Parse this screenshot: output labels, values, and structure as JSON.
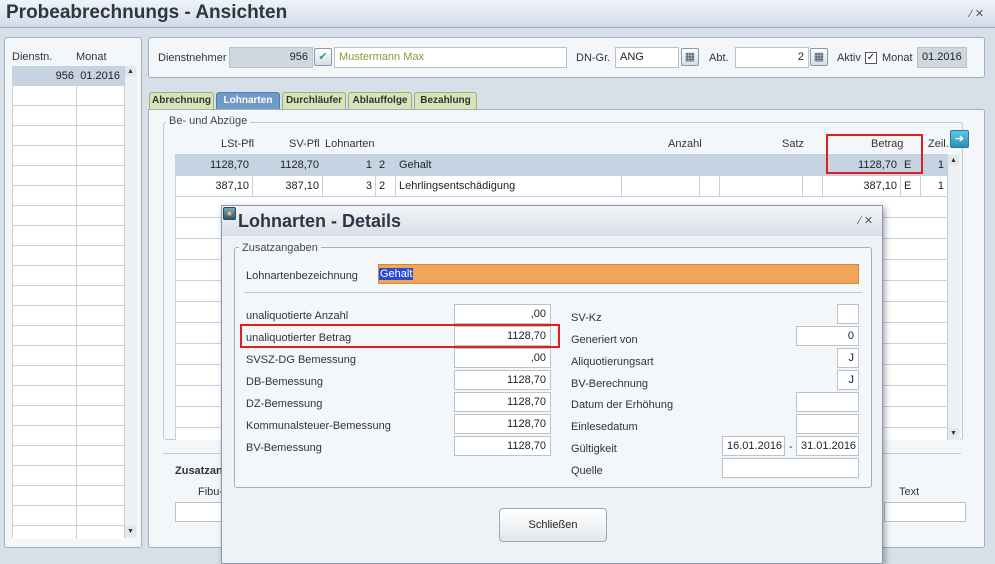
{
  "window": {
    "title": "Probeabrechnungs - Ansichten",
    "controls": "∕ ✕"
  },
  "left_list": {
    "headers": [
      "Dienstn.",
      "Monat"
    ],
    "rows": [
      {
        "dienstn": "956",
        "monat": "01.2016"
      }
    ]
  },
  "header_form": {
    "dienstnehmer_label": "Dienstnehmer",
    "dienstnehmer_nr": "956",
    "dienstnehmer_name": "Mustermann Max",
    "dngr_label": "DN-Gr.",
    "dngr_value": "ANG",
    "abt_label": "Abt.",
    "abt_value": "2",
    "aktiv_label": "Aktiv",
    "monat_label": "Monat",
    "monat_value": "01.2016"
  },
  "tabs": [
    "Abrechnung",
    "Lohnarten",
    "Durchläufer",
    "Ablauffolge",
    "Bezahlung"
  ],
  "active_tab": "Lohnarten",
  "table": {
    "group_title": "Be- und Abzüge",
    "headers": {
      "lst": "LSt-Pfl",
      "sv": "SV-Pfl",
      "lohnarten": "Lohnarten",
      "anzahl": "Anzahl",
      "satz": "Satz",
      "betrag": "Betrag",
      "zeil": "Zeil."
    },
    "rows": [
      {
        "lst": "1128,70",
        "sv": "1128,70",
        "la1": "1",
        "la2": "2",
        "bez": "Gehalt",
        "betrag": "1128,70",
        "e": "E",
        "zeil": "1"
      },
      {
        "lst": "387,10",
        "sv": "387,10",
        "la1": "3",
        "la2": "2",
        "bez": "Lehrlingsentschädigung",
        "betrag": "387,10",
        "e": "E",
        "zeil": "1"
      }
    ]
  },
  "bottom": {
    "zusatz_label": "Zusatzang",
    "fibu_label": "Fibu-",
    "text_label": "Text"
  },
  "dialog": {
    "title": "Lohnarten - Details",
    "group_title": "Zusatzangaben",
    "lohnartenbezeichnung_label": "Lohnartenbezeichnung",
    "lohnartenbezeichnung_value": "Gehalt",
    "left_fields": [
      {
        "label": "unaliquotierte Anzahl",
        "value": ",00"
      },
      {
        "label": "unaliquotierter Betrag",
        "value": "1128,70"
      },
      {
        "label": "SVSZ-DG Bemessung",
        "value": ",00"
      },
      {
        "label": "DB-Bemessung",
        "value": "1128,70"
      },
      {
        "label": "DZ-Bemessung",
        "value": "1128,70"
      },
      {
        "label": "Kommunalsteuer-Bemessung",
        "value": "1128,70"
      },
      {
        "label": "BV-Bemessung",
        "value": "1128,70"
      }
    ],
    "right_fields": {
      "svkz_label": "SV-Kz",
      "svkz_value": "",
      "generiert_label": "Generiert von",
      "generiert_value": "0",
      "aliquot_label": "Aliquotierungsart",
      "aliquot_value": "J",
      "bvber_label": "BV-Berechnung",
      "bvber_value": "J",
      "erhoehung_label": "Datum der Erhöhung",
      "erhoehung_value": "",
      "einlese_label": "Einlesedatum",
      "einlese_value": "",
      "gueltig_label": "Gültigkeit",
      "gueltig_from": "16.01.2016",
      "gueltig_sep": "-",
      "gueltig_to": "31.01.2016",
      "quelle_label": "Quelle",
      "quelle_value": ""
    },
    "close_label": "Schließen",
    "controls": "∕ ✕"
  },
  "colors": {
    "accent_tab": "#6f9ac8",
    "highlight": "#f2a65a",
    "selection": "#c5d3e2",
    "annotation_red": "#e02020"
  }
}
